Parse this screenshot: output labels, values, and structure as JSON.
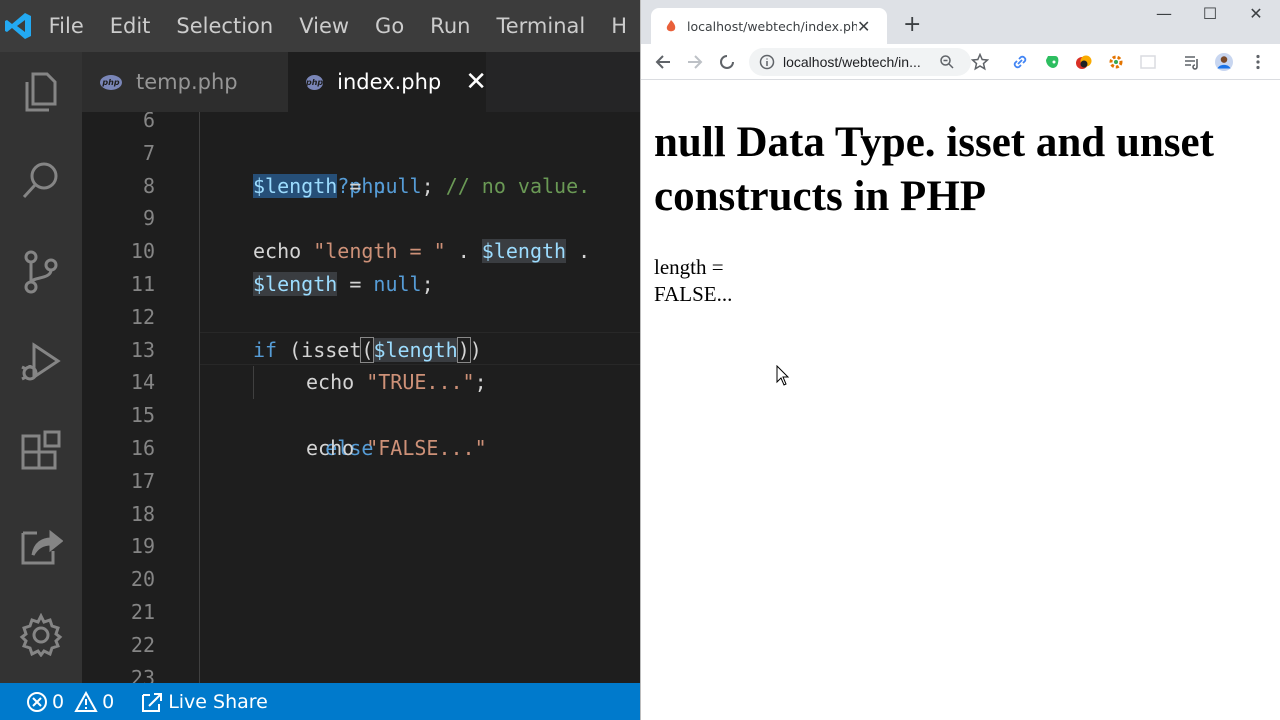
{
  "vscode": {
    "menu": [
      "File",
      "Edit",
      "Selection",
      "View",
      "Go",
      "Run",
      "Terminal",
      "H"
    ],
    "tabs": [
      {
        "badge": "php",
        "label": "temp.php",
        "active": false
      },
      {
        "badge": "php",
        "label": "index.php",
        "active": true,
        "close": "✕"
      }
    ],
    "line_numbers": [
      "6",
      "7",
      "8",
      "9",
      "10",
      "11",
      "12",
      "13",
      "14",
      "15",
      "16",
      "17",
      "18",
      "19",
      "20",
      "21",
      "22",
      "23"
    ],
    "code": {
      "l7": "<?php",
      "l8_var": "$length",
      "l8_eq": " = ",
      "l8_null": "null",
      "l8_semi": "; ",
      "l8_cmt": "// no value.",
      "l10_echo": "echo ",
      "l10_str": "\"length = \"",
      "l10_dot": " . ",
      "l10_var": "$length",
      "l10_dot2": " .",
      "l11_var": "$length",
      "l11_eq": " = ",
      "l11_null": "null",
      "l11_semi": ";",
      "l13_if": "if",
      "l13_open": " (isset",
      "l13_p1": "(",
      "l13_var": "$length",
      "l13_p2": ")",
      "l13_close": ")",
      "l14_echo": "echo ",
      "l14_str": "\"TRUE...\"",
      "l14_semi": ";",
      "l15_else": "else",
      "l16_echo": "echo ",
      "l16_str": "\"FALSE...\"",
      "l23": "?>"
    },
    "status": {
      "errors": "0",
      "warnings": "0",
      "live_share": "Live Share"
    },
    "colors": {
      "statusbar": "#007acc",
      "keyword": "#569cd6",
      "variable": "#9cdcfe",
      "string": "#ce9178",
      "comment": "#6a9955"
    }
  },
  "chrome": {
    "tab_title": "localhost/webtech/index.php",
    "tab_close": "✕",
    "new_tab": "+",
    "address": "localhost/webtech/in...",
    "window_controls": [
      "—",
      "☐",
      "✕"
    ],
    "page": {
      "heading": "null Data Type. isset and unset constructs in PHP",
      "line1": "length =",
      "line2": "FALSE..."
    }
  }
}
